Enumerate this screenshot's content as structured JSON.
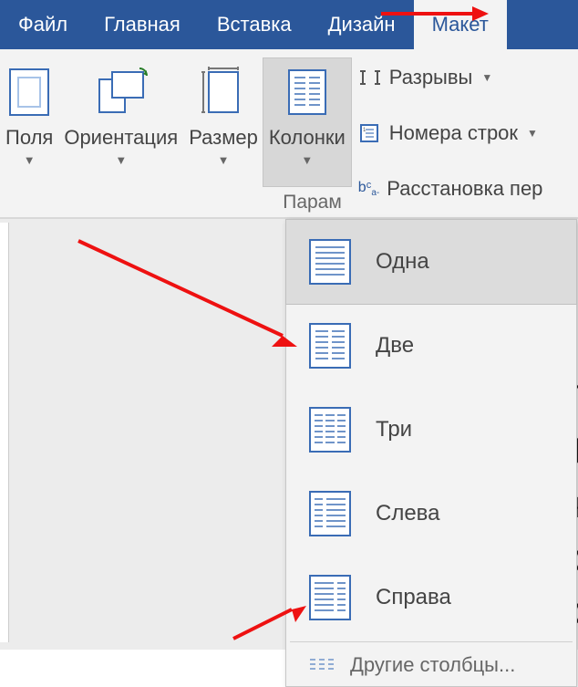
{
  "tabs": {
    "file": "Файл",
    "home": "Главная",
    "insert": "Вставка",
    "design": "Дизайн",
    "layout": "Макет"
  },
  "ribbon": {
    "margins": "Поля",
    "orientation": "Ориентация",
    "size": "Размер",
    "columns": "Колонки",
    "group_label": "Парам",
    "breaks": "Разрывы",
    "line_numbers": "Номера строк",
    "hyphenation": "Расстановка пер"
  },
  "columns_menu": {
    "one": "Одна",
    "two": "Две",
    "three": "Три",
    "left": "Слева",
    "right": "Справа",
    "more": "Другие столбцы..."
  },
  "doc_fragment": [
    "Г",
    "J",
    "ч",
    "с",
    "с"
  ]
}
